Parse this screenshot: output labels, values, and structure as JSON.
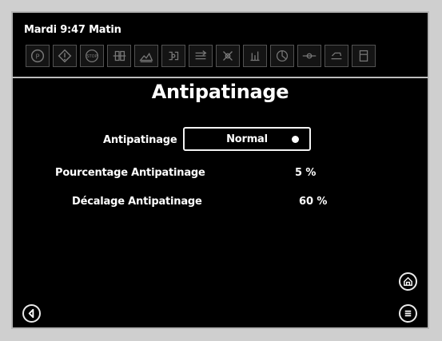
{
  "status_bar": {
    "time_text": "Mardi 9:47 Matin",
    "indicators": [
      {
        "name": "parking-brake-indicator-icon"
      },
      {
        "name": "warning-indicator-icon"
      },
      {
        "name": "stop-indicator-icon"
      },
      {
        "name": "traction-indicator-icon"
      },
      {
        "name": "terrain-indicator-icon"
      },
      {
        "name": "circuit-indicator-icon"
      },
      {
        "name": "transmission-indicator-icon"
      },
      {
        "name": "hydraulic-indicator-icon"
      },
      {
        "name": "lift-indicator-icon"
      },
      {
        "name": "pto-indicator-icon"
      },
      {
        "name": "axle-indicator-icon"
      },
      {
        "name": "implement-indicator-icon"
      },
      {
        "name": "fuel-indicator-icon"
      }
    ]
  },
  "page": {
    "title": "Antipatinage"
  },
  "settings": {
    "mode_label": "Antipatinage",
    "mode_value": "Normal",
    "percentage_label": "Pourcentage Antipatinage",
    "percentage_value": "5 %",
    "offset_label": "Décalage Antipatinage",
    "offset_value": "60 %"
  },
  "buttons": {
    "back_icon": "back-arrow-icon",
    "home_icon": "home-icon",
    "menu_icon": "menu-icon"
  }
}
